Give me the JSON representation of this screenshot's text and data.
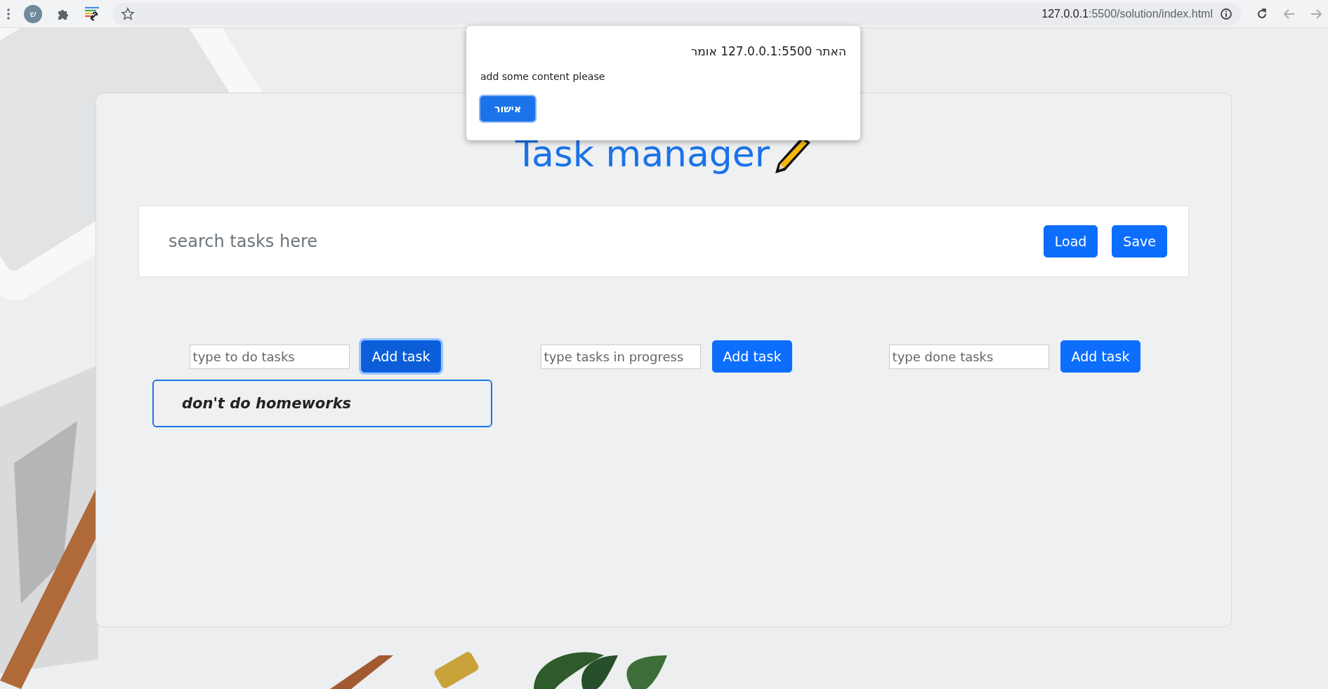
{
  "browser": {
    "profile_initial": "ש",
    "url_host": "127.0.0.1",
    "url_rest": ":5500/solution/index.html"
  },
  "dialog": {
    "title": "האתר 127.0.0.1:5500 אומר",
    "message": "add some content please",
    "ok_button": "אישור"
  },
  "app": {
    "title": "Task manager",
    "search": {
      "placeholder": "search tasks here"
    },
    "buttons": [
      "Load",
      "Save"
    ],
    "columns": [
      {
        "placeholder": "type to do tasks",
        "button": {
          "label": "Add task",
          "focused": true
        },
        "tasks": [
          "don't do homeworks"
        ]
      },
      {
        "placeholder": "type tasks in progress",
        "button": {
          "label": "Add task",
          "focused": false
        }
      },
      {
        "placeholder": "type done tasks",
        "button": {
          "label": "Add task",
          "focused": false
        }
      }
    ]
  }
}
